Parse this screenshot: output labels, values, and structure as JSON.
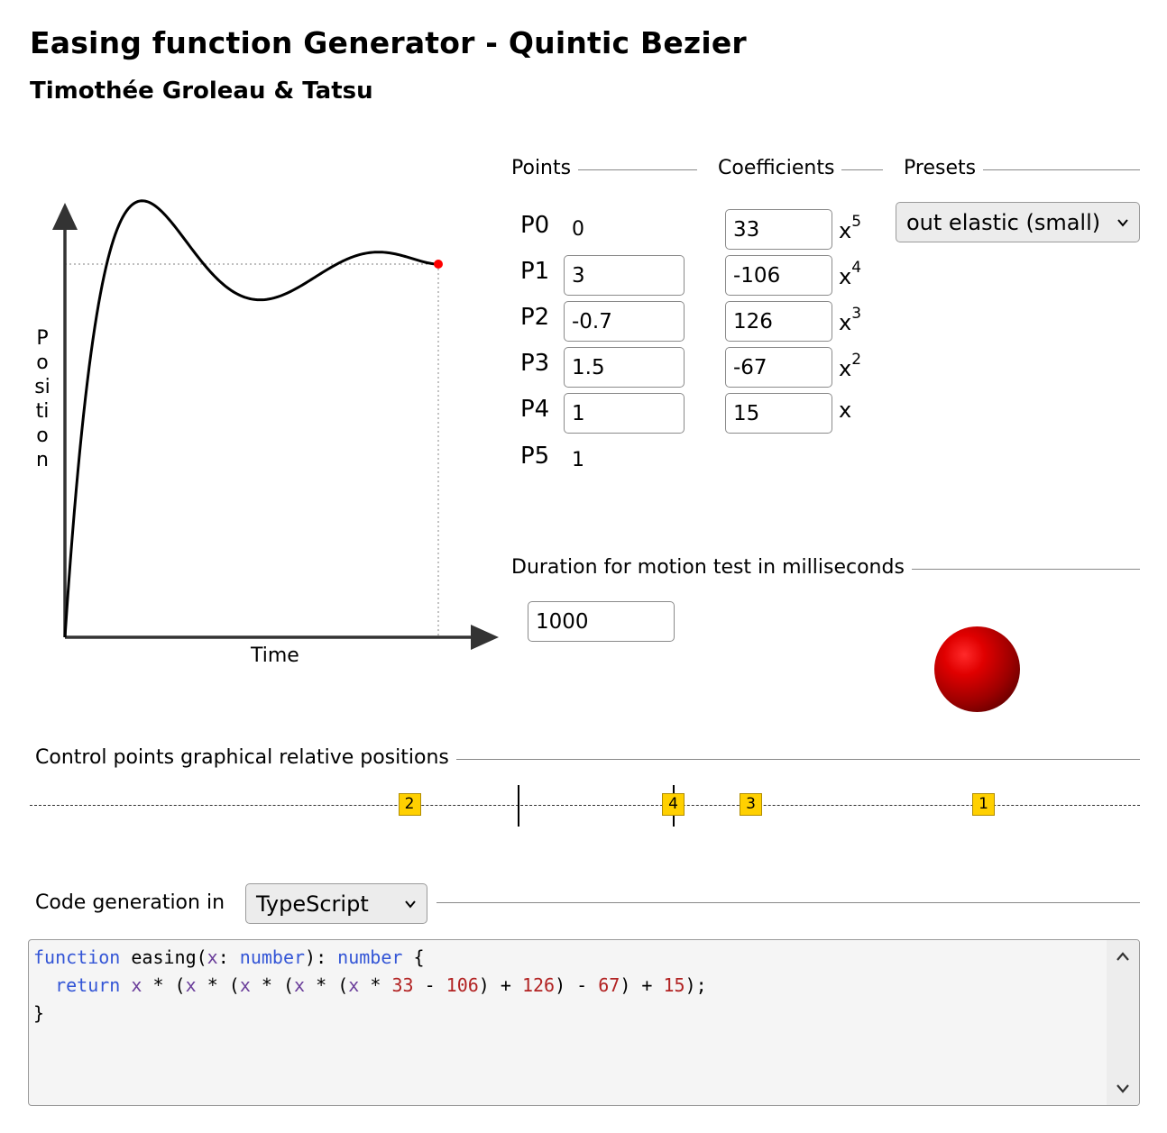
{
  "header": {
    "title": "Easing function Generator - Quintic Bezier",
    "authors": "Timothée Groleau & Tatsu"
  },
  "graph": {
    "y_axis_label": "Position",
    "x_axis_label": "Time",
    "curve_color": "#000000",
    "end_point_color": "#ff0000"
  },
  "points": {
    "heading": "Points",
    "rows": [
      {
        "label": "P0",
        "value": "0"
      },
      {
        "label": "P1",
        "value": "3"
      },
      {
        "label": "P2",
        "value": "-0.7"
      },
      {
        "label": "P3",
        "value": "1.5"
      },
      {
        "label": "P4",
        "value": "1"
      },
      {
        "label": "P5",
        "value": "1"
      }
    ]
  },
  "coefficients": {
    "heading": "Coefficients",
    "rows": [
      {
        "value": "33",
        "base": "x",
        "power": "5"
      },
      {
        "value": "-106",
        "base": "x",
        "power": "4"
      },
      {
        "value": "126",
        "base": "x",
        "power": "3"
      },
      {
        "value": "-67",
        "base": "x",
        "power": "2"
      },
      {
        "value": "15",
        "base": "x",
        "power": ""
      }
    ]
  },
  "presets": {
    "heading": "Presets",
    "selected": "out elastic (small)",
    "icon": "chevron-down-icon"
  },
  "duration": {
    "heading": "Duration for motion test in milliseconds",
    "value": "1000",
    "ball_color": "#d40000"
  },
  "control_points": {
    "heading": "Control points graphical relative positions",
    "markers": [
      {
        "label": "2",
        "value": -0.7
      },
      {
        "label": "4",
        "value": 1
      },
      {
        "label": "3",
        "value": 1.5
      },
      {
        "label": "1",
        "value": 3
      }
    ],
    "reference_ticks": [
      0,
      1
    ],
    "marker_color": "#ffd000"
  },
  "codegen": {
    "label": "Code generation in",
    "language": "TypeScript",
    "icon": "chevron-down-icon",
    "lines": [
      "function easing(x: number): number {",
      "  return x * (x * (x * (x * (x * 33 - 106) + 126) - 67) + 15);",
      "}"
    ]
  }
}
